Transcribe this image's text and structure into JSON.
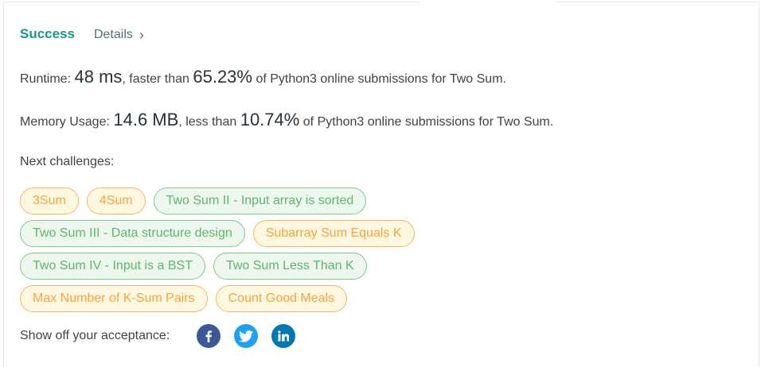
{
  "result": {
    "status": "Success",
    "details_label": "Details",
    "details_chevron": "›"
  },
  "runtime": {
    "label": "Runtime:",
    "value": "48 ms",
    "comparison_prefix": ", faster than",
    "percent": "65.23%",
    "suffix": "of Python3 online submissions for Two Sum."
  },
  "memory": {
    "label": "Memory Usage:",
    "value": "14.6 MB",
    "comparison_prefix": ", less than",
    "percent": "10.74%",
    "suffix": "of Python3 online submissions for Two Sum."
  },
  "next_challenges": {
    "label": "Next challenges:",
    "rows": [
      [
        {
          "label": "3Sum",
          "difficulty": "medium"
        },
        {
          "label": "4Sum",
          "difficulty": "medium"
        },
        {
          "label": "Two Sum II - Input array is sorted",
          "difficulty": "easy"
        }
      ],
      [
        {
          "label": "Two Sum III - Data structure design",
          "difficulty": "easy"
        },
        {
          "label": "Subarray Sum Equals K",
          "difficulty": "medium"
        }
      ],
      [
        {
          "label": "Two Sum IV - Input is a BST",
          "difficulty": "easy"
        },
        {
          "label": "Two Sum Less Than K",
          "difficulty": "easy"
        }
      ],
      [
        {
          "label": "Max Number of K-Sum Pairs",
          "difficulty": "medium"
        },
        {
          "label": "Count Good Meals",
          "difficulty": "medium"
        }
      ]
    ]
  },
  "share": {
    "label": "Show off your acceptance:",
    "networks": [
      {
        "name": "facebook-icon",
        "color": "#3b5998"
      },
      {
        "name": "twitter-icon",
        "color": "#1da1f2"
      },
      {
        "name": "linkedin-icon",
        "color": "#0077b5"
      }
    ]
  },
  "colors": {
    "success": "#1a9a86",
    "medium_border": "#f9b45a",
    "medium_text": "#f8a33d",
    "medium_bg": "#fff8e1",
    "easy_border": "#7dc98a",
    "easy_text": "#5cb76b",
    "easy_bg": "#edf7ee"
  }
}
